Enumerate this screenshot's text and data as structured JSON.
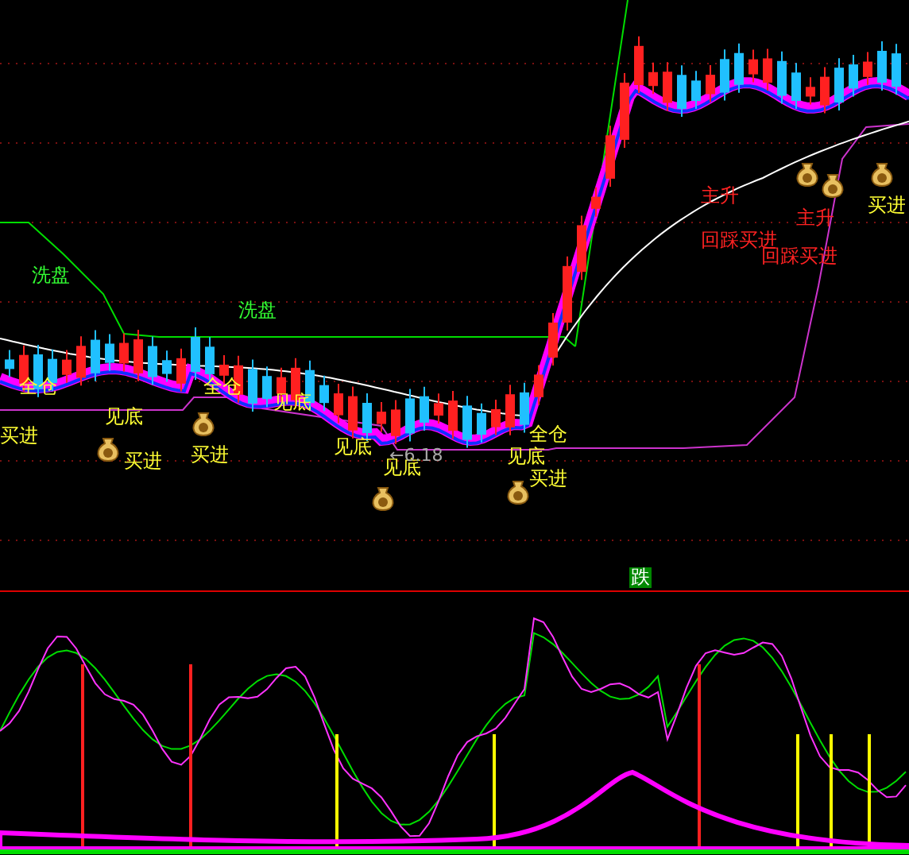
{
  "signals": [
    {
      "text": "洗盘",
      "kind": "wash"
    },
    {
      "text": "洗盘",
      "kind": "wash"
    },
    {
      "text": "全仓",
      "kind": "buy"
    },
    {
      "text": "全仓",
      "kind": "buy"
    },
    {
      "text": "全仓",
      "kind": "buy"
    },
    {
      "text": "买进",
      "kind": "buy"
    },
    {
      "text": "买进",
      "kind": "buy"
    },
    {
      "text": "买进",
      "kind": "buy"
    },
    {
      "text": "买进",
      "kind": "buy"
    },
    {
      "text": "买进",
      "kind": "buy"
    },
    {
      "text": "见底",
      "kind": "buy"
    },
    {
      "text": "见底",
      "kind": "buy"
    },
    {
      "text": "见底",
      "kind": "buy"
    },
    {
      "text": "见底",
      "kind": "buy"
    },
    {
      "text": "见底",
      "kind": "buy"
    },
    {
      "text": "主升",
      "kind": "rise"
    },
    {
      "text": "主升",
      "kind": "rise"
    },
    {
      "text": "回踩买进",
      "kind": "rise"
    },
    {
      "text": "回踩买进",
      "kind": "rise"
    }
  ],
  "low_price_label": "←6.18",
  "indicator_marker": {
    "text": "跌"
  }
}
